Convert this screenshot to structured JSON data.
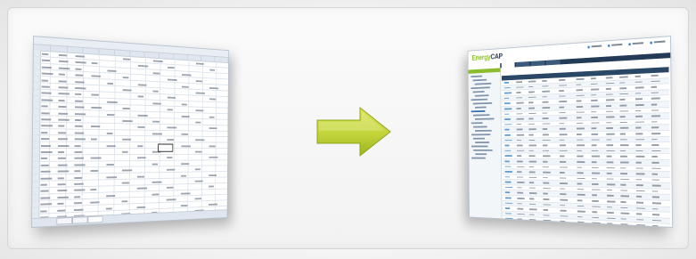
{
  "scene": {
    "description_free": true
  },
  "left_panel": {
    "selected_cell_value": "",
    "tabs": [
      "",
      "",
      ""
    ]
  },
  "right_panel": {
    "logo_prefix": "Energy",
    "logo_suffix": "CAP",
    "brand_colors": {
      "green": "#8bbd2e",
      "navy": "#233b57",
      "blue": "#3a86c8"
    }
  },
  "arrow": {
    "color_light": "#d4e04a",
    "color_dark": "#9cb31f"
  }
}
